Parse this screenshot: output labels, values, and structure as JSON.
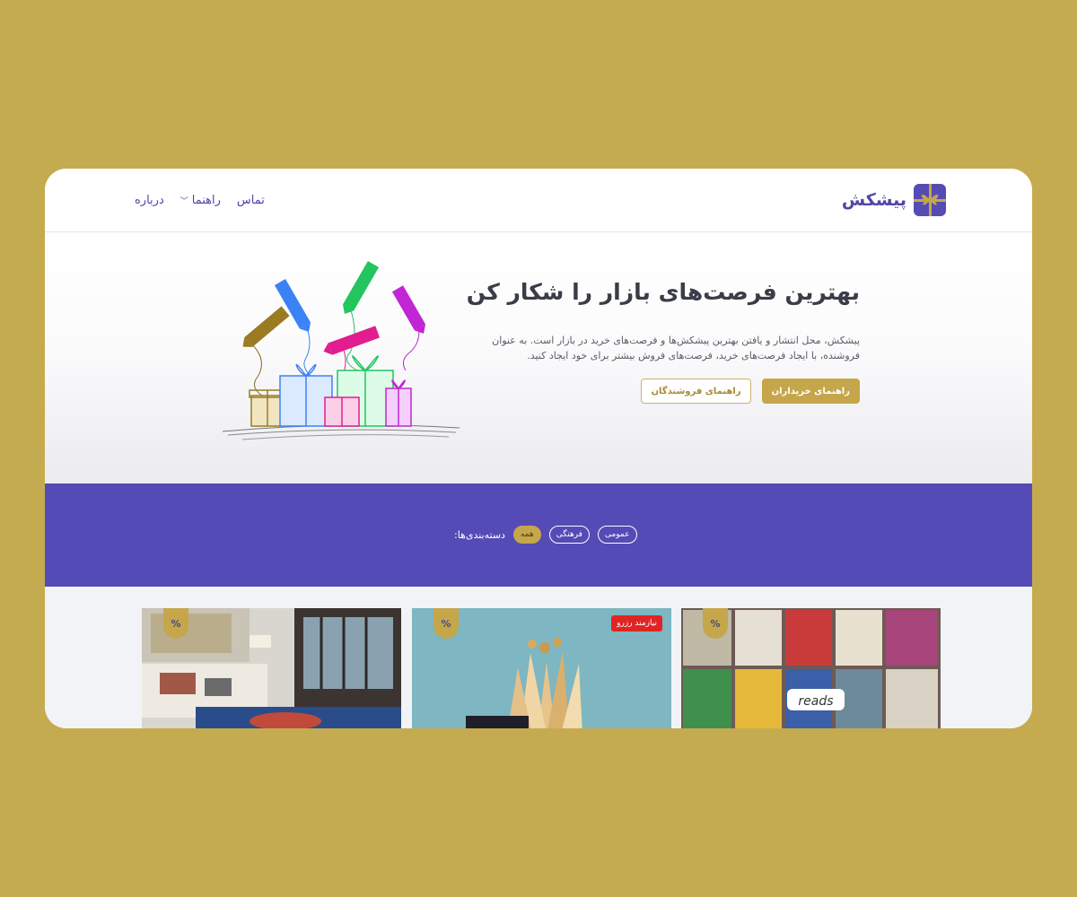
{
  "brand": {
    "name": "پیشکش",
    "logo_icon": "gift-box-icon"
  },
  "nav": {
    "items": [
      {
        "label": "درباره"
      },
      {
        "label": "راهنما",
        "has_dropdown": true
      },
      {
        "label": "تماس"
      }
    ]
  },
  "hero": {
    "title": "بهترین فرصت‌های بازار را شکار کن",
    "description": "پیشکش، محل انتشار و یافتن بهترین پیشکش‌ها و فرصت‌های خرید در بازار است. به عنوان فروشنده، با ایجاد فرصت‌های خرید، فرصت‌های فروش بیشتر برای خود ایجاد کنید.",
    "buyers_button": "راهنمای خریداران",
    "sellers_button": "راهنمای فروشندگان",
    "illustration": "gift-boxes-with-price-tags"
  },
  "categories": {
    "label": "دسته‌بندی‌ها:",
    "items": [
      {
        "label": "همه",
        "active": true
      },
      {
        "label": "فرهنگی",
        "active": false
      },
      {
        "label": "عمومی",
        "active": false
      }
    ]
  },
  "cards": [
    {
      "badge_icon": "percent-icon",
      "badge_text": "%",
      "image": "books-collage",
      "status": ""
    },
    {
      "badge_icon": "percent-icon",
      "badge_text": "%",
      "image": "wheat-bouquet",
      "status": "نیازمند رزرو"
    },
    {
      "badge_icon": "percent-icon",
      "badge_text": "%",
      "image": "living-room-rug",
      "status": ""
    }
  ],
  "colors": {
    "page_background": "#c5ab50",
    "brand_purple": "#544bb6",
    "accent_gold": "#c5a64a",
    "reserve_red": "#e02424"
  }
}
